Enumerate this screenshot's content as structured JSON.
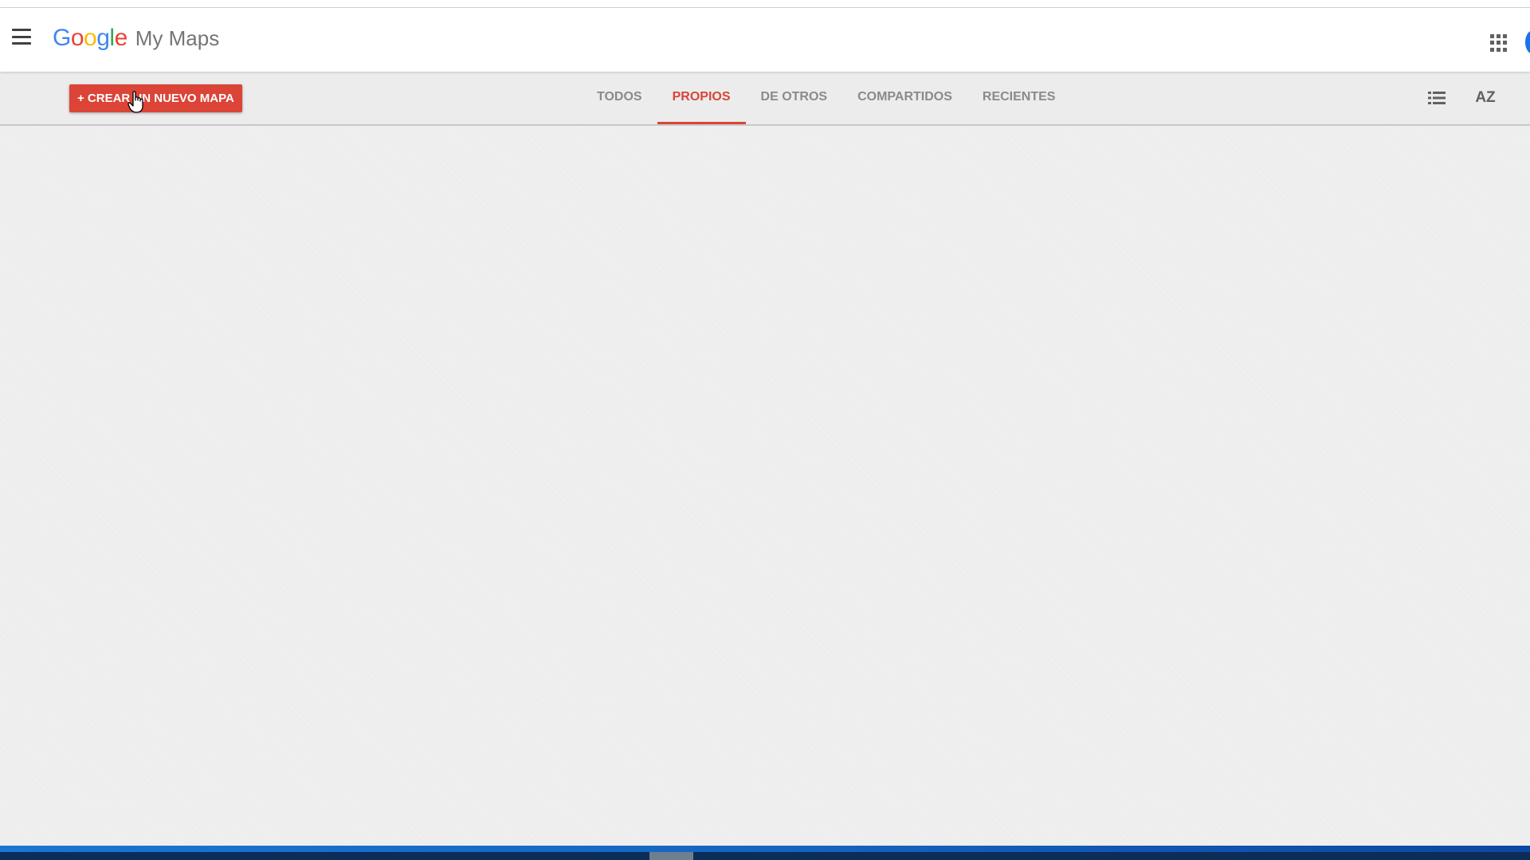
{
  "app": {
    "brand": {
      "G": "G",
      "o1": "o",
      "o2": "o",
      "g": "g",
      "l": "l",
      "e": "e"
    },
    "brand_colors": {
      "blue": "#4285f4",
      "red": "#ea4335",
      "yellow": "#fbbc05",
      "green": "#34a853"
    },
    "product_name": "My Maps",
    "accent_color": "#db4437"
  },
  "header": {
    "menu_icon": "hamburger-menu-icon",
    "apps_icon": "apps-grid-icon"
  },
  "toolbar": {
    "create_label": "+ CREAR UN NUEVO MAPA",
    "tabs": [
      {
        "label": "TODOS",
        "active": false
      },
      {
        "label": "PROPIOS",
        "active": true
      },
      {
        "label": "DE OTROS",
        "active": false
      },
      {
        "label": "COMPARTIDOS",
        "active": false
      },
      {
        "label": "RECIENTES",
        "active": false
      }
    ],
    "list_view_icon": "list-view-icon",
    "sort_label": "AZ"
  }
}
